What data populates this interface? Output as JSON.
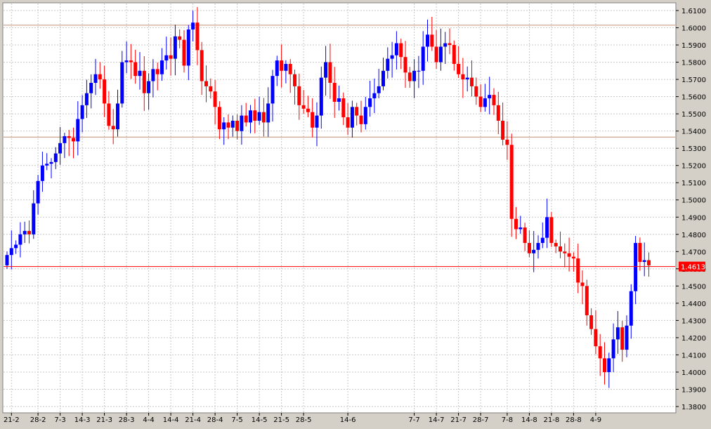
{
  "chart_data": {
    "type": "candlestick",
    "title": "",
    "ylim": [
      1.375,
      1.615
    ],
    "y_ticks": [
      "1.6100",
      "1.6000",
      "1.5900",
      "1.5800",
      "1.5700",
      "1.5600",
      "1.5500",
      "1.5400",
      "1.5300",
      "1.5200",
      "1.5100",
      "1.5000",
      "1.4900",
      "1.4800",
      "1.4700",
      "1.4600",
      "1.4500",
      "1.4400",
      "1.4300",
      "1.4200",
      "1.4100",
      "1.4000",
      "1.3900",
      "1.3800"
    ],
    "x_ticks": [
      {
        "index": 1,
        "label": "21-2"
      },
      {
        "index": 7,
        "label": "28-2"
      },
      {
        "index": 12,
        "label": "7-3"
      },
      {
        "index": 17,
        "label": "14-3"
      },
      {
        "index": 22,
        "label": "21-3"
      },
      {
        "index": 27,
        "label": "28-3"
      },
      {
        "index": 32,
        "label": "4-4"
      },
      {
        "index": 37,
        "label": "14-4"
      },
      {
        "index": 42,
        "label": "21-4"
      },
      {
        "index": 47,
        "label": "28-4"
      },
      {
        "index": 52,
        "label": "7-5"
      },
      {
        "index": 57,
        "label": "14-5"
      },
      {
        "index": 62,
        "label": "21-5"
      },
      {
        "index": 67,
        "label": "28-5"
      },
      {
        "index": 77,
        "label": "14-6"
      },
      {
        "index": 92,
        "label": "7-7"
      },
      {
        "index": 97,
        "label": "14-7"
      },
      {
        "index": 102,
        "label": "21-7"
      },
      {
        "index": 107,
        "label": "28-7"
      },
      {
        "index": 113,
        "label": "7-8"
      },
      {
        "index": 118,
        "label": "14-8"
      },
      {
        "index": 123,
        "label": "21-8"
      },
      {
        "index": 128,
        "label": "28-8"
      },
      {
        "index": 133,
        "label": "4-9"
      }
    ],
    "horizontal_lines": [
      {
        "value": 1.6015,
        "color": "#c09070"
      },
      {
        "value": 1.5365,
        "color": "#c09070"
      }
    ],
    "current_price": {
      "value": 1.4613,
      "label": "1.4613",
      "color": "#ff0000"
    },
    "up_color": "#0000ff",
    "down_color": "#ff0000",
    "grid": true,
    "closes": [
      1.468,
      1.472,
      1.474,
      1.48,
      1.482,
      1.48,
      1.498,
      1.511,
      1.52,
      1.521,
      1.522,
      1.527,
      1.533,
      1.537,
      1.536,
      1.534,
      1.547,
      1.555,
      1.562,
      1.568,
      1.573,
      1.57,
      1.556,
      1.543,
      1.541,
      1.556,
      1.58,
      1.581,
      1.58,
      1.572,
      1.575,
      1.562,
      1.569,
      1.576,
      1.573,
      1.581,
      1.584,
      1.582,
      1.595,
      1.593,
      1.578,
      1.599,
      1.603,
      1.587,
      1.569,
      1.566,
      1.563,
      1.554,
      1.541,
      1.545,
      1.542,
      1.546,
      1.54,
      1.549,
      1.545,
      1.552,
      1.546,
      1.551,
      1.545,
      1.556,
      1.572,
      1.581,
      1.575,
      1.579,
      1.573,
      1.566,
      1.555,
      1.553,
      1.551,
      1.542,
      1.549,
      1.571,
      1.58,
      1.568,
      1.557,
      1.559,
      1.548,
      1.542,
      1.554,
      1.549,
      1.544,
      1.554,
      1.559,
      1.562,
      1.566,
      1.575,
      1.582,
      1.584,
      1.591,
      1.583,
      1.574,
      1.569,
      1.575,
      1.575,
      1.589,
      1.596,
      1.589,
      1.58,
      1.589,
      1.591,
      1.59,
      1.579,
      1.573,
      1.57,
      1.571,
      1.566,
      1.56,
      1.554,
      1.559,
      1.561,
      1.555,
      1.546,
      1.535,
      1.532,
      1.489,
      1.483,
      1.484,
      1.475,
      1.469,
      1.471,
      1.475,
      1.478,
      1.49,
      1.475,
      1.473,
      1.47,
      1.469,
      1.467,
      1.466,
      1.452,
      1.45,
      1.433,
      1.425,
      1.415,
      1.408,
      1.4,
      1.408,
      1.419,
      1.426,
      1.413,
      1.427,
      1.447,
      1.475,
      1.464,
      1.465,
      1.462
    ],
    "ohlc": []
  }
}
